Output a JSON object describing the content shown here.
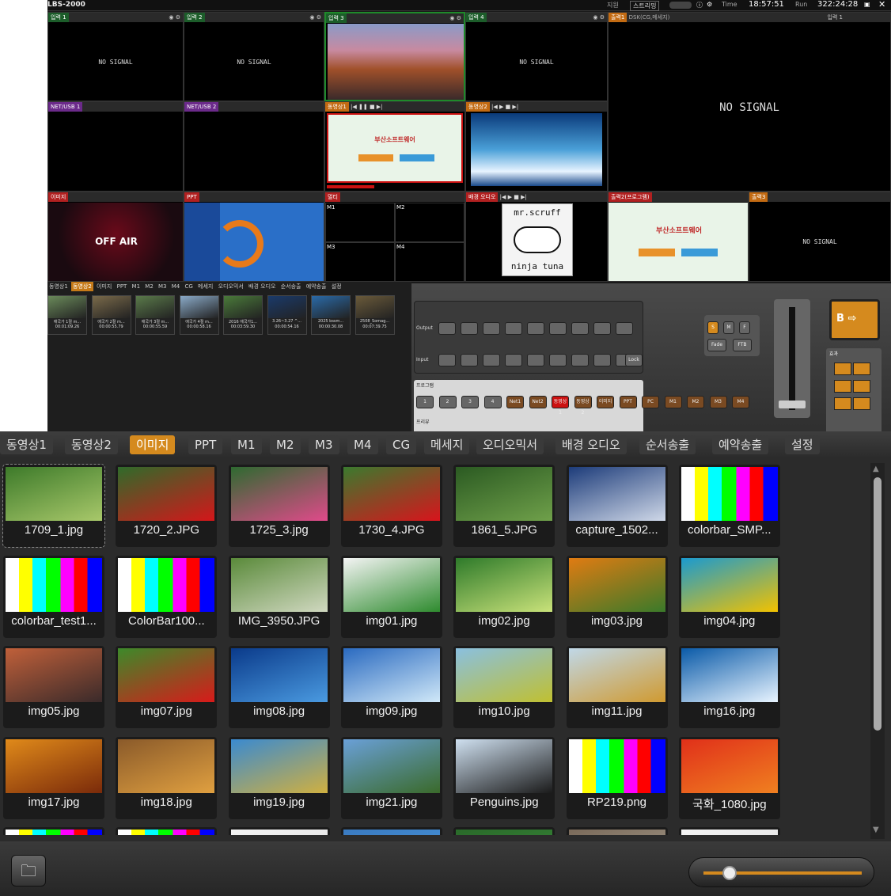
{
  "app": {
    "title": "LBS-2000",
    "support": "지원",
    "stream": "스트리밍",
    "time_label": "Time",
    "time": "18:57:51",
    "run_label": "Run",
    "run": "322:24:28"
  },
  "tiles": {
    "in1": "입력 1",
    "in2": "입력 2",
    "in3": "입력 3",
    "in4": "입력 4",
    "net1": "NET/USB 1",
    "net2": "NET/USB 2",
    "vid1": "동영상1",
    "vid2": "동영상2",
    "out1": "출력1",
    "dsk": "DSK(CG,메세지)",
    "sel": "입력 1",
    "img": "이미지",
    "ppt": "PPT",
    "multi": "멀티",
    "bgaudio": "배경 오디오",
    "out2": "출력2(프로그램)",
    "out3": "출력3",
    "pgm": "출력(PGM)",
    "nosignal": "NO SIGNAL",
    "offair": "OFF AIR",
    "m1": "M1",
    "m2": "M2",
    "m3": "M3",
    "m4": "M4",
    "busan": "부산소프트웨어",
    "ninja1": "mr.scruff",
    "ninja2": "ninja tuna"
  },
  "small_tabs": [
    "동영상1",
    "동영상2",
    "이미지",
    "PPT",
    "M1",
    "M2",
    "M3",
    "M4",
    "CG",
    "메세지",
    "오디오믹서",
    "배경 오디오",
    "순서송출",
    "예약송출",
    "설정"
  ],
  "small_thumbs": [
    {
      "t1": "애국가 1절 m...",
      "t2": "00:01:09.26"
    },
    {
      "t1": "애국가 2절 m...",
      "t2": "00:00:55.79"
    },
    {
      "t1": "애국가 3절 m...",
      "t2": "00:00:55.59"
    },
    {
      "t1": "애국가 4절 m...",
      "t2": "00:00:58.16"
    },
    {
      "t1": "2016 애국가1...",
      "t2": "00:03:59.30"
    },
    {
      "t1": "3.26~3.27 ^...",
      "t2": "00:00:54.16"
    },
    {
      "t1": "2025 bssm...",
      "t2": "00:00:30.08"
    },
    {
      "t1": "2508_Somag...",
      "t2": "00:07:39.75"
    }
  ],
  "control": {
    "output": "Output",
    "input": "Input",
    "program": "프로그램",
    "preview": "프리뷰",
    "prog_buttons": [
      "1",
      "2",
      "3",
      "4",
      "Net1",
      "Net2",
      "동영상1",
      "동영상2",
      "이미지",
      "PPT",
      "PC",
      "M1",
      "M2",
      "M3",
      "M4"
    ],
    "lock": "Lock",
    "s": "S",
    "m": "M",
    "f": "F",
    "fade": "Fade",
    "ftb": "FTB",
    "b": "B",
    "effects": "효과"
  },
  "tabs": [
    "동영상1",
    "동영상2",
    "이미지",
    "PPT",
    "M1",
    "M2",
    "M3",
    "M4",
    "CG",
    "메세지",
    "오디오믹서",
    "배경 오디오",
    "순서송출",
    "예약송출",
    "설정"
  ],
  "active_tab": "이미지",
  "images": [
    {
      "name": "1709_1.jpg",
      "c1": "#3d7a2a",
      "c2": "#a8c86a"
    },
    {
      "name": "1720_2.JPG",
      "c1": "#2f6b2a",
      "c2": "#d4161a"
    },
    {
      "name": "1725_3.jpg",
      "c1": "#2e6a30",
      "c2": "#e04a8a"
    },
    {
      "name": "1730_4.JPG",
      "c1": "#3b7a2e",
      "c2": "#d8141c"
    },
    {
      "name": "1861_5.JPG",
      "c1": "#2b5a22",
      "c2": "#6fa04a"
    },
    {
      "name": "capture_1502...",
      "c1": "#1d3c7a",
      "c2": "#cfd8e8"
    },
    {
      "name": "colorbar_SMP...",
      "c1": "#bbbbbb",
      "c2": "#1a1aa0"
    },
    {
      "name": "colorbar_test1...",
      "c1": "#ffff00",
      "c2": "#00ffff"
    },
    {
      "name": "ColorBar100...",
      "c1": "#ffff00",
      "c2": "#ff00ff"
    },
    {
      "name": "IMG_3950.JPG",
      "c1": "#5a8a3a",
      "c2": "#d0d8c0"
    },
    {
      "name": "img01.jpg",
      "c1": "#f4f4f4",
      "c2": "#2e8b2e"
    },
    {
      "name": "img02.jpg",
      "c1": "#2e7a2a",
      "c2": "#c9e27a"
    },
    {
      "name": "img03.jpg",
      "c1": "#e07b12",
      "c2": "#3a7a2a"
    },
    {
      "name": "img04.jpg",
      "c1": "#1a9ad0",
      "c2": "#f2c200"
    },
    {
      "name": "img05.jpg",
      "c1": "#c0603a",
      "c2": "#3a2a2a"
    },
    {
      "name": "img07.jpg",
      "c1": "#3c8a2a",
      "c2": "#d81a1a"
    },
    {
      "name": "img08.jpg",
      "c1": "#0a3a8a",
      "c2": "#4a9ae0"
    },
    {
      "name": "img09.jpg",
      "c1": "#2a6ac0",
      "c2": "#d0e8f8"
    },
    {
      "name": "img10.jpg",
      "c1": "#8ac0e0",
      "c2": "#c0c030"
    },
    {
      "name": "img11.jpg",
      "c1": "#c0d8e8",
      "c2": "#d09a30"
    },
    {
      "name": "img16.jpg",
      "c1": "#0a5aa8",
      "c2": "#e8f4ff"
    },
    {
      "name": "img17.jpg",
      "c1": "#e08a1a",
      "c2": "#7a2a0a"
    },
    {
      "name": "img18.jpg",
      "c1": "#8a5a2a",
      "c2": "#e0a040"
    },
    {
      "name": "img19.jpg",
      "c1": "#3a8ad0",
      "c2": "#d0b040"
    },
    {
      "name": "img21.jpg",
      "c1": "#6aa0d8",
      "c2": "#3a6a2a"
    },
    {
      "name": "Penguins.jpg",
      "c1": "#cfe0f0",
      "c2": "#1a1a1a"
    },
    {
      "name": "RP219.png",
      "c1": "#bbbbbb",
      "c2": "#000000"
    },
    {
      "name": "국화_1080.jpg",
      "c1": "#e0301a",
      "c2": "#f08020"
    },
    {
      "name": "",
      "c1": "#ffff00",
      "c2": "#ff00ff"
    },
    {
      "name": "",
      "c1": "#ffff00",
      "c2": "#00ffff"
    },
    {
      "name": "",
      "c1": "#f4f4f4",
      "c2": "#dddddd"
    },
    {
      "name": "",
      "c1": "#3a7ac0",
      "c2": "#4a9ae0"
    },
    {
      "name": "",
      "c1": "#2a6a2a",
      "c2": "#3a8a3a"
    },
    {
      "name": "",
      "c1": "#7a6a5a",
      "c2": "#aaa090"
    },
    {
      "name": "",
      "c1": "#f4f4f4",
      "c2": "#dddddd"
    }
  ],
  "colors": {
    "accent": "#d58a1e",
    "panel": "#2b2b2b",
    "selected_output_border": "#c11"
  },
  "zoom_level": 0.12
}
